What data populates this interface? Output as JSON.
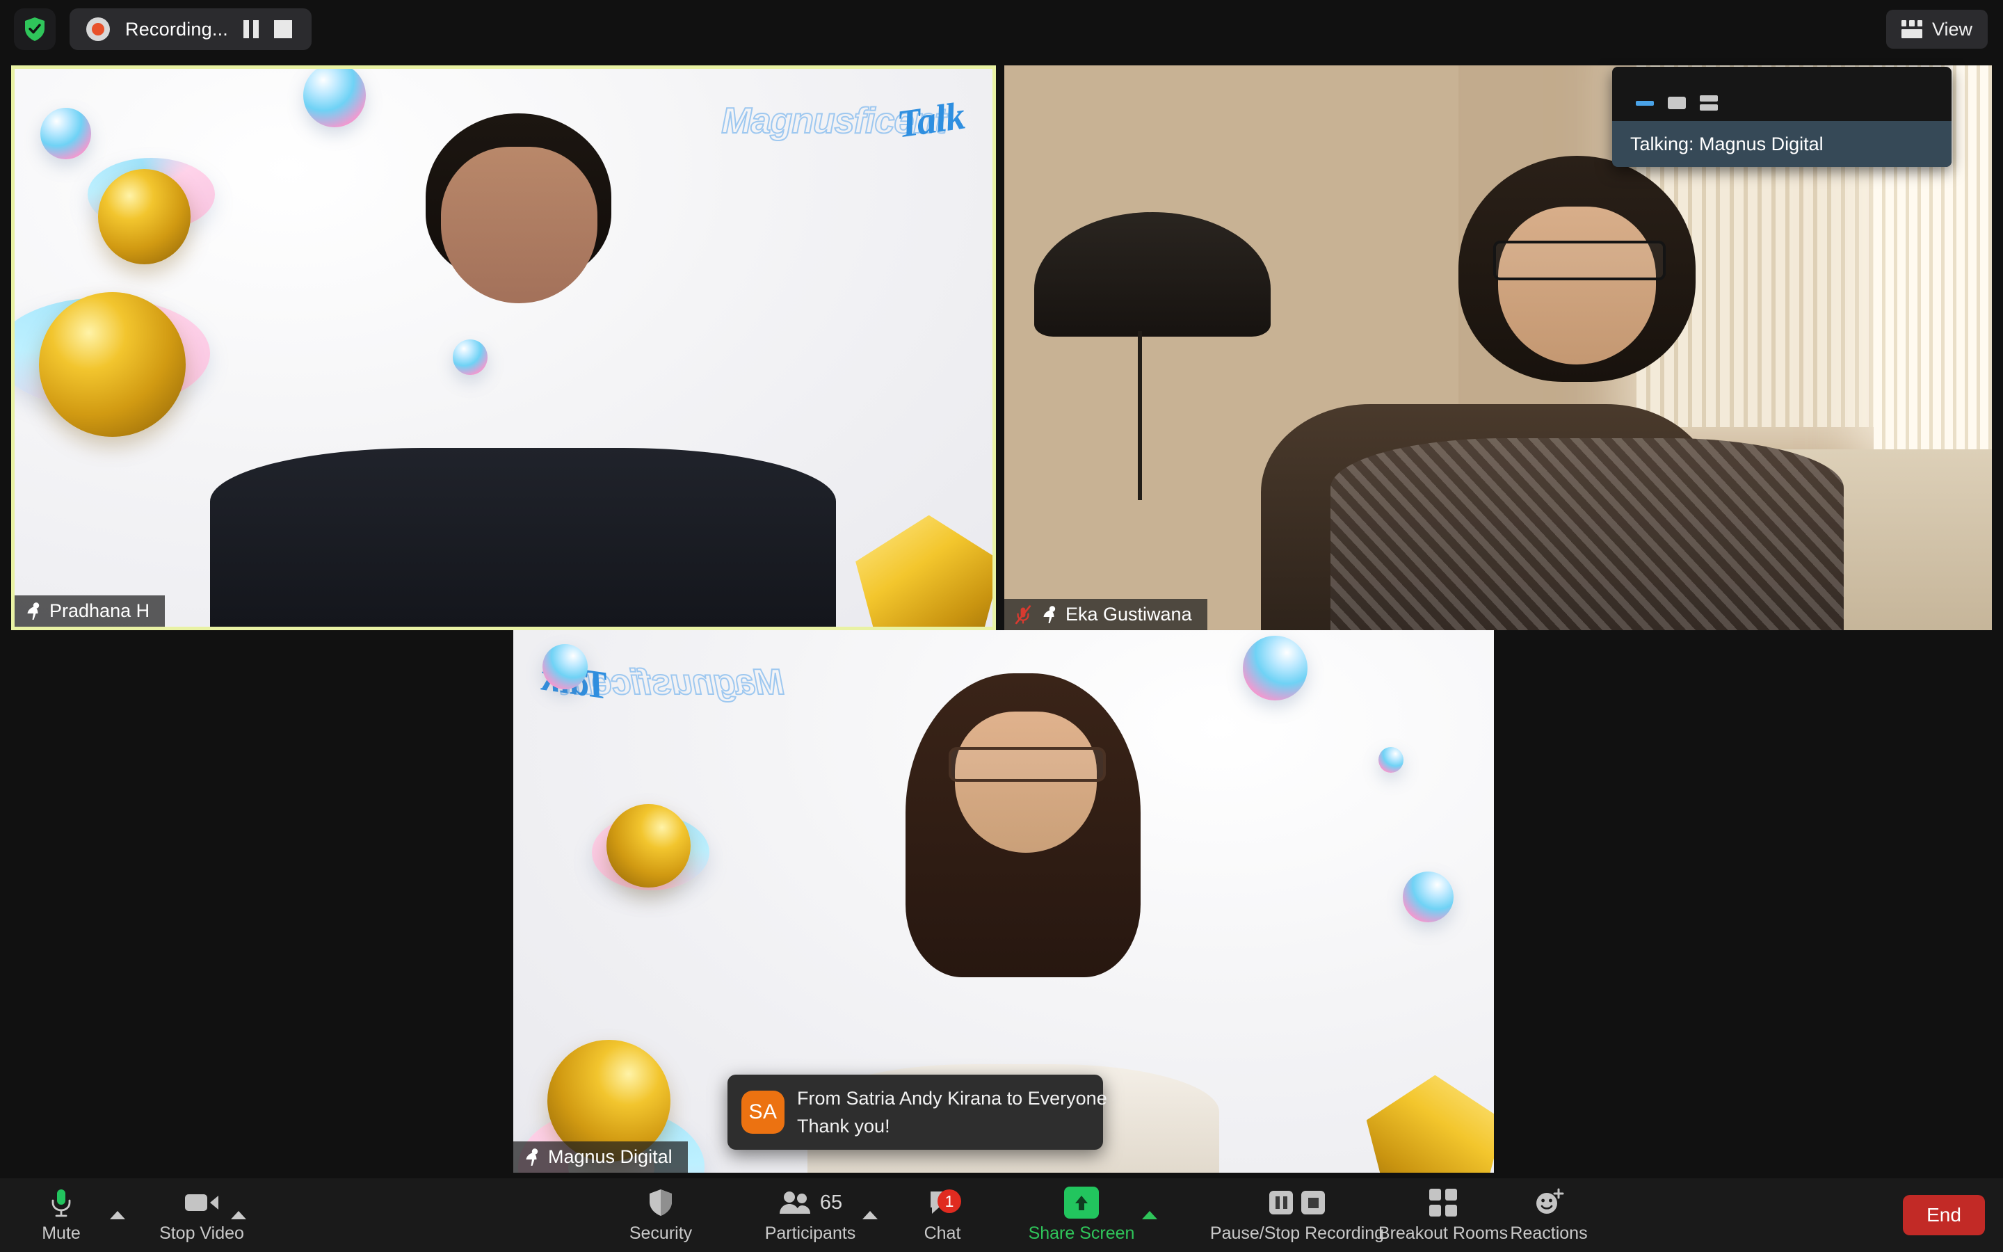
{
  "topbar": {
    "shield_icon": "security-shield-check-icon",
    "recording_icon": "record-dot-icon",
    "recording_label": "Recording...",
    "pause_icon": "pause-icon",
    "stop_icon": "stop-icon",
    "view_icon": "layout-grid-icon",
    "view_label": "View"
  },
  "talking_panel": {
    "minimize_icon": "minimize-icon",
    "single_pane_icon": "single-pane-icon",
    "split_pane_icon": "split-pane-icon",
    "status_text": "Talking: Magnus Digital",
    "bar_color": "#364957",
    "active_control_color": "#4aa3e8"
  },
  "video_tiles": [
    {
      "name": "Pradhana H",
      "pin_icon": "pin-icon",
      "muted": false,
      "active_speaker": true,
      "border_color": "#e9f2a4",
      "background_brand": "Magnusficent",
      "background_brand_script": "Talk"
    },
    {
      "name": "Eka Gustiwana",
      "pin_icon": "pin-icon",
      "mic_off_icon": "mic-muted-icon",
      "muted": true,
      "active_speaker": false
    },
    {
      "name": "Magnus Digital",
      "pin_icon": "pin-icon",
      "muted": false,
      "active_speaker": false,
      "background_brand": "Magnusficent",
      "background_brand_script": "Talk"
    }
  ],
  "chat_toast": {
    "avatar_initials": "SA",
    "avatar_color": "#ec7211",
    "from_line": "From Satria Andy Kirana to Everyone",
    "message": "Thank you!"
  },
  "toolbar": {
    "mute": {
      "label": "Mute",
      "icon": "microphone-icon",
      "caret_icon": "chevron-up-icon",
      "icon_color": "#22c55e"
    },
    "video": {
      "label": "Stop Video",
      "icon": "video-camera-icon",
      "caret_icon": "chevron-up-icon"
    },
    "security": {
      "label": "Security",
      "icon": "shield-icon"
    },
    "participants": {
      "label": "Participants",
      "icon": "people-icon",
      "count": "65",
      "caret_icon": "chevron-up-icon"
    },
    "chat": {
      "label": "Chat",
      "icon": "chat-bubble-icon",
      "badge": "1",
      "badge_color": "#e02b20"
    },
    "share": {
      "label": "Share Screen",
      "icon": "share-arrow-up-icon",
      "caret_icon": "chevron-up-icon",
      "color": "#2fc55a"
    },
    "recording": {
      "label": "Pause/Stop Recording",
      "pause_icon": "pause-icon",
      "stop_icon": "stop-icon"
    },
    "breakout": {
      "label": "Breakout Rooms",
      "icon": "grid-four-icon"
    },
    "reactions": {
      "label": "Reactions",
      "icon": "smiley-plus-icon"
    },
    "end": {
      "label": "End",
      "color": "#c22a26"
    }
  }
}
